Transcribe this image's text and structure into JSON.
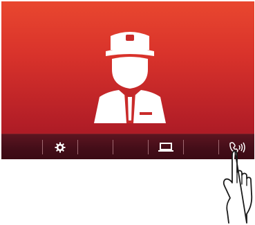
{
  "screen": {
    "state": "incoming-call",
    "caller": {
      "icon": "guard-avatar-icon"
    },
    "colors": {
      "accent": "#d8322b",
      "toolbar": "#420d18",
      "icon": "#ffffff"
    }
  },
  "toolbar": {
    "buttons": [
      {
        "id": "settings",
        "icon": "gear-icon"
      },
      {
        "id": "blank-1",
        "icon": ""
      },
      {
        "id": "monitor",
        "icon": "monitor-icon"
      },
      {
        "id": "talk",
        "icon": "talk-icon"
      }
    ]
  },
  "gesture": {
    "icon": "pointing-hand-icon",
    "target": "talk"
  }
}
